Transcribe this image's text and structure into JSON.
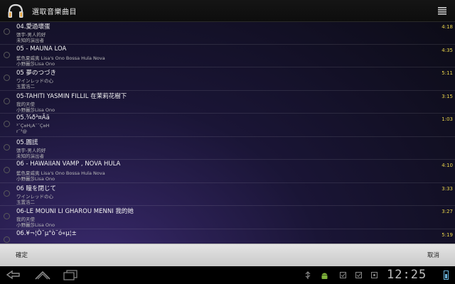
{
  "header": {
    "title": "選取音樂曲目",
    "app_icon": "headphones-icon",
    "menu_icon": "menu-icon"
  },
  "songs": [
    {
      "title": "04.愛過壞蛋",
      "line2": "張宇-男人的好",
      "line3": "未知的演出者",
      "duration": "4:18"
    },
    {
      "title": "05 - MAUNA LOA",
      "line2": "藍色夏威夷 Lisa's Ono Bossa Hula Nova",
      "line3": "小野麗莎Lisa Ono",
      "duration": "4:35"
    },
    {
      "title": "05 夢のつづき",
      "line2": "ワインレッドの心",
      "line3": "玉置浩二",
      "duration": "5:11"
    },
    {
      "title": "05-TAHITI YASMIN FILLIL 在茉莉花樹下",
      "line2": "我的天使",
      "line3": "小野麗莎Lisa Ono",
      "duration": "3:15"
    },
    {
      "title": "05.¾ð³¤Ãä",
      "line2": "³¯Ç¤H¡A¨¯Ç¤H",
      "line3": "r¯³@",
      "duration": "1:03"
    },
    {
      "title": "05.圓謊",
      "line2": "張宇-男人的好",
      "line3": "未知的演出者",
      "duration": ""
    },
    {
      "title": "06 - HAWAIIAN VAMP , NOVA HULA",
      "line2": "藍色夏威夷 Lisa's Ono Bossa Hula Nova",
      "line3": "小野麗莎Lisa Ono",
      "duration": "4:10"
    },
    {
      "title": "06 瞳を閉じて",
      "line2": "ワインレッドの心",
      "line3": "玉置浩二",
      "duration": "3:33"
    },
    {
      "title": "06-LE MOUNI LI GHAROU MENNI  我的她",
      "line2": "我的天使",
      "line3": "小野麗莎Lisa Ono",
      "duration": "3:27"
    },
    {
      "title": "06.¥¬¦Ò¯µ°ò¨ó«µ¦±",
      "line2": "",
      "line3": "",
      "duration": "5:19"
    }
  ],
  "buttons": {
    "ok": "確定",
    "cancel": "取消"
  },
  "system": {
    "clock": "12:25",
    "battery_level": 0.7
  },
  "colors": {
    "duration": "#e8d34a",
    "accent": "#6cb6e0"
  }
}
